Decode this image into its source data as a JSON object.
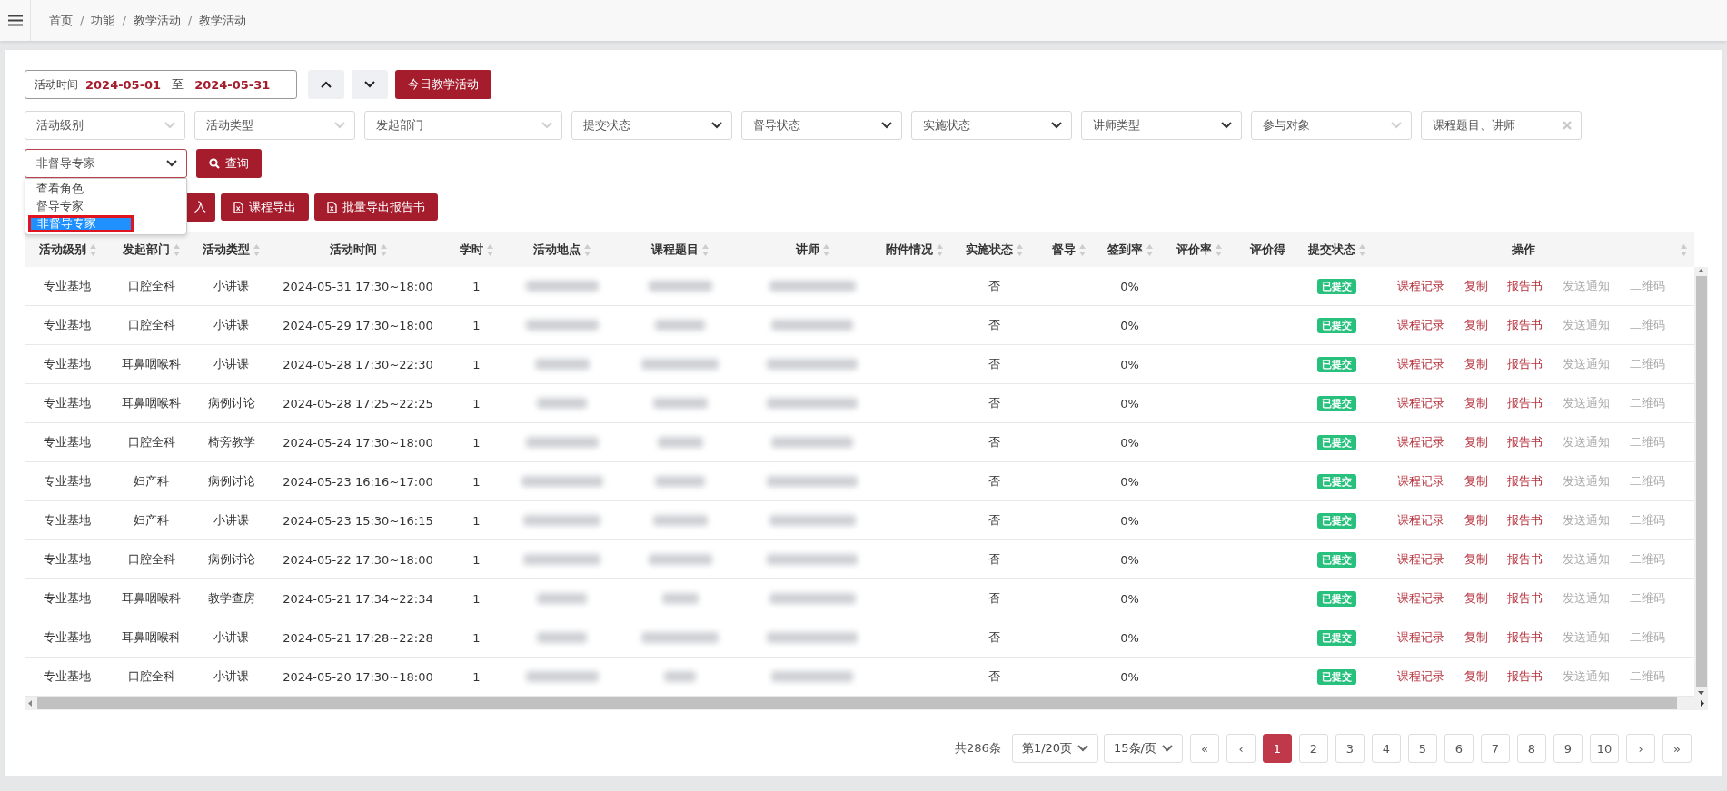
{
  "breadcrumb": [
    {
      "kind": "link",
      "text": "首页"
    },
    {
      "kind": "separator",
      "text": "/"
    },
    {
      "kind": "link",
      "text": "功能"
    },
    {
      "kind": "separator",
      "text": "/"
    },
    {
      "kind": "link",
      "text": "教学活动"
    },
    {
      "kind": "separator",
      "text": "/"
    },
    {
      "kind": "link",
      "text": "教学活动"
    }
  ],
  "date_range": {
    "label": "活动时间",
    "start": "2024-05-01",
    "separator": "至",
    "end": "2024-05-31"
  },
  "today_button": "今日教学活动",
  "filters": [
    {
      "kind": "multi",
      "placeholder": "活动级别"
    },
    {
      "kind": "multi",
      "placeholder": "活动类型"
    },
    {
      "kind": "multi",
      "placeholder": "发起部门",
      "wide": true
    },
    {
      "kind": "select",
      "placeholder": "提交状态"
    },
    {
      "kind": "select",
      "placeholder": "督导状态"
    },
    {
      "kind": "select",
      "placeholder": "实施状态"
    },
    {
      "kind": "select",
      "placeholder": "讲师类型"
    },
    {
      "kind": "multi",
      "placeholder": "参与对象"
    },
    {
      "kind": "search",
      "placeholder": "课程题目、讲师"
    }
  ],
  "role_select": {
    "value": "非督导专家",
    "expanded": true,
    "options": [
      {
        "label": "查看角色",
        "selected": false
      },
      {
        "label": "督导专家",
        "selected": false
      },
      {
        "label": "非督导专家",
        "selected": true
      }
    ]
  },
  "query_button": "查询",
  "toolbar": [
    {
      "kind": "partial",
      "label": "入"
    },
    {
      "kind": "excel",
      "label": "课程导出"
    },
    {
      "kind": "excel",
      "label": "批量导出报告书"
    }
  ],
  "table": {
    "columns": [
      {
        "label": "活动级别",
        "sortable": true
      },
      {
        "label": "发起部门",
        "sortable": true
      },
      {
        "label": "活动类型",
        "sortable": true
      },
      {
        "label": "活动时间",
        "sortable": true
      },
      {
        "label": "学时",
        "sortable": true
      },
      {
        "label": "活动地点",
        "sortable": true,
        "blurred": true
      },
      {
        "label": "课程题目",
        "sortable": true,
        "blurred": true
      },
      {
        "label": "讲师",
        "sortable": true,
        "blurred": true
      },
      {
        "label": "附件情况",
        "sortable": true
      },
      {
        "label": "实施状态",
        "sortable": true
      },
      {
        "label": "督导",
        "sortable": true
      },
      {
        "label": "签到率",
        "sortable": true
      },
      {
        "label": "评价率",
        "sortable": true
      },
      {
        "label": "评价得"
      },
      {
        "label": "提交状态",
        "sortable": true
      },
      {
        "label": "操作",
        "sortable": true
      }
    ],
    "rows": [
      {
        "cells": [
          "专业基地",
          "口腔全科",
          "小讲课",
          "2024-05-31 17:30~18:00",
          "1",
          "",
          "",
          "",
          "",
          "否",
          "",
          "0%",
          "",
          "",
          "已提交"
        ],
        "actions": [
          {
            "label": "课程记录",
            "disabled": false
          },
          {
            "label": "复制",
            "disabled": false
          },
          {
            "label": "报告书",
            "disabled": false
          },
          {
            "label": "发送通知",
            "disabled": true
          },
          {
            "label": "二维码",
            "disabled": true
          }
        ]
      },
      {
        "cells": [
          "专业基地",
          "口腔全科",
          "小讲课",
          "2024-05-29 17:30~18:00",
          "1",
          "",
          "",
          "",
          "",
          "否",
          "",
          "0%",
          "",
          "",
          "已提交"
        ],
        "actions": [
          {
            "label": "课程记录",
            "disabled": false
          },
          {
            "label": "复制",
            "disabled": false
          },
          {
            "label": "报告书",
            "disabled": false
          },
          {
            "label": "发送通知",
            "disabled": true
          },
          {
            "label": "二维码",
            "disabled": true
          }
        ]
      },
      {
        "cells": [
          "专业基地",
          "耳鼻咽喉科",
          "小讲课",
          "2024-05-28 17:30~22:30",
          "1",
          "",
          "",
          "",
          "",
          "否",
          "",
          "0%",
          "",
          "",
          "已提交"
        ],
        "actions": [
          {
            "label": "课程记录",
            "disabled": false
          },
          {
            "label": "复制",
            "disabled": false
          },
          {
            "label": "报告书",
            "disabled": false
          },
          {
            "label": "发送通知",
            "disabled": true
          },
          {
            "label": "二维码",
            "disabled": true
          }
        ]
      },
      {
        "cells": [
          "专业基地",
          "耳鼻咽喉科",
          "病例讨论",
          "2024-05-28 17:25~22:25",
          "1",
          "",
          "",
          "",
          "",
          "否",
          "",
          "0%",
          "",
          "",
          "已提交"
        ],
        "actions": [
          {
            "label": "课程记录",
            "disabled": false
          },
          {
            "label": "复制",
            "disabled": false
          },
          {
            "label": "报告书",
            "disabled": false
          },
          {
            "label": "发送通知",
            "disabled": true
          },
          {
            "label": "二维码",
            "disabled": true
          }
        ]
      },
      {
        "cells": [
          "专业基地",
          "口腔全科",
          "椅旁教学",
          "2024-05-24 17:30~18:00",
          "1",
          "",
          "",
          "",
          "",
          "否",
          "",
          "0%",
          "",
          "",
          "已提交"
        ],
        "actions": [
          {
            "label": "课程记录",
            "disabled": false
          },
          {
            "label": "复制",
            "disabled": false
          },
          {
            "label": "报告书",
            "disabled": false
          },
          {
            "label": "发送通知",
            "disabled": true
          },
          {
            "label": "二维码",
            "disabled": true
          }
        ]
      },
      {
        "cells": [
          "专业基地",
          "妇产科",
          "病例讨论",
          "2024-05-23 16:16~17:00",
          "1",
          "",
          "",
          "",
          "",
          "否",
          "",
          "0%",
          "",
          "",
          "已提交"
        ],
        "actions": [
          {
            "label": "课程记录",
            "disabled": false
          },
          {
            "label": "复制",
            "disabled": false
          },
          {
            "label": "报告书",
            "disabled": false
          },
          {
            "label": "发送通知",
            "disabled": true
          },
          {
            "label": "二维码",
            "disabled": true
          }
        ]
      },
      {
        "cells": [
          "专业基地",
          "妇产科",
          "小讲课",
          "2024-05-23 15:30~16:15",
          "1",
          "",
          "",
          "",
          "",
          "否",
          "",
          "0%",
          "",
          "",
          "已提交"
        ],
        "actions": [
          {
            "label": "课程记录",
            "disabled": false
          },
          {
            "label": "复制",
            "disabled": false
          },
          {
            "label": "报告书",
            "disabled": false
          },
          {
            "label": "发送通知",
            "disabled": true
          },
          {
            "label": "二维码",
            "disabled": true
          }
        ]
      },
      {
        "cells": [
          "专业基地",
          "口腔全科",
          "病例讨论",
          "2024-05-22 17:30~18:00",
          "1",
          "",
          "",
          "",
          "",
          "否",
          "",
          "0%",
          "",
          "",
          "已提交"
        ],
        "actions": [
          {
            "label": "课程记录",
            "disabled": false
          },
          {
            "label": "复制",
            "disabled": false
          },
          {
            "label": "报告书",
            "disabled": false
          },
          {
            "label": "发送通知",
            "disabled": true
          },
          {
            "label": "二维码",
            "disabled": true
          }
        ]
      },
      {
        "cells": [
          "专业基地",
          "耳鼻咽喉科",
          "教学查房",
          "2024-05-21 17:34~22:34",
          "1",
          "",
          "",
          "",
          "",
          "否",
          "",
          "0%",
          "",
          "",
          "已提交"
        ],
        "actions": [
          {
            "label": "课程记录",
            "disabled": false
          },
          {
            "label": "复制",
            "disabled": false
          },
          {
            "label": "报告书",
            "disabled": false
          },
          {
            "label": "发送通知",
            "disabled": true
          },
          {
            "label": "二维码",
            "disabled": true
          }
        ]
      },
      {
        "cells": [
          "专业基地",
          "耳鼻咽喉科",
          "小讲课",
          "2024-05-21 17:28~22:28",
          "1",
          "",
          "",
          "",
          "",
          "否",
          "",
          "0%",
          "",
          "",
          "已提交"
        ],
        "actions": [
          {
            "label": "课程记录",
            "disabled": false
          },
          {
            "label": "复制",
            "disabled": false
          },
          {
            "label": "报告书",
            "disabled": false
          },
          {
            "label": "发送通知",
            "disabled": true
          },
          {
            "label": "二维码",
            "disabled": true
          }
        ]
      },
      {
        "cells": [
          "专业基地",
          "口腔全科",
          "小讲课",
          "2024-05-20 17:30~18:00",
          "1",
          "",
          "",
          "",
          "",
          "否",
          "",
          "0%",
          "",
          "",
          "已提交"
        ],
        "actions": [
          {
            "label": "课程记录",
            "disabled": false
          },
          {
            "label": "复制",
            "disabled": false
          },
          {
            "label": "报告书",
            "disabled": false
          },
          {
            "label": "发送通知",
            "disabled": true
          },
          {
            "label": "二维码",
            "disabled": true
          }
        ]
      }
    ]
  },
  "pagination": {
    "total": "共286条",
    "page_select": "第1/20页",
    "size_select": "15条/页",
    "first": "«",
    "prev": "‹",
    "pages": [
      {
        "label": "1",
        "selected": true
      },
      {
        "label": "2",
        "selected": false
      },
      {
        "label": "3",
        "selected": false
      },
      {
        "label": "4",
        "selected": false
      },
      {
        "label": "5",
        "selected": false
      },
      {
        "label": "6",
        "selected": false
      },
      {
        "label": "7",
        "selected": false
      },
      {
        "label": "8",
        "selected": false
      },
      {
        "label": "9",
        "selected": false
      },
      {
        "label": "10",
        "selected": false
      }
    ],
    "next": "›",
    "last": "»"
  }
}
